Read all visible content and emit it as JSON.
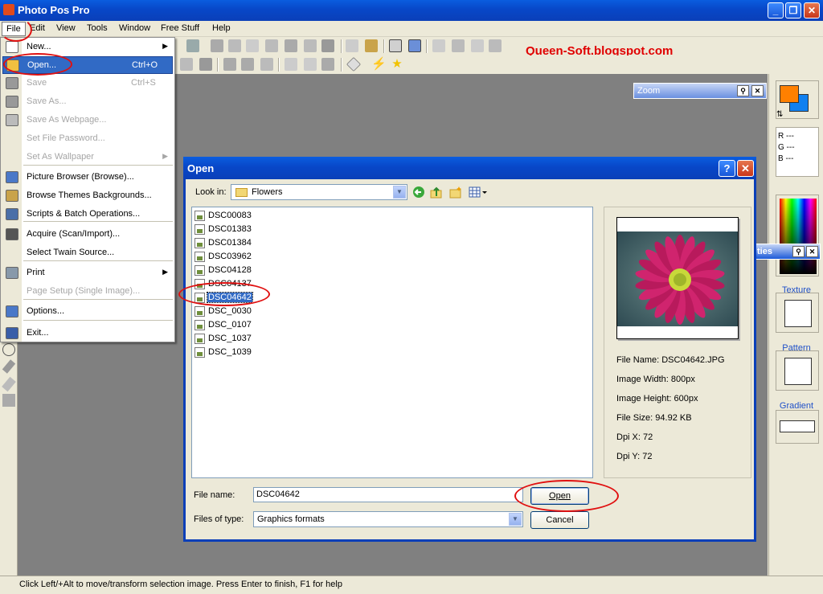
{
  "app": {
    "title": "Photo Pos Pro",
    "window_buttons": {
      "minimize": "_",
      "maximize": "❐",
      "close": "✕"
    }
  },
  "menubar": [
    "File",
    "Edit",
    "View",
    "Tools",
    "Window",
    "Free Stuff",
    "Help"
  ],
  "watermark": "Queen-Soft.blogspot.com",
  "file_menu": {
    "items": [
      {
        "label": "New...",
        "shortcut": "",
        "submenu": true,
        "disabled": false
      },
      {
        "label": "Open...",
        "shortcut": "Ctrl+O",
        "submenu": false,
        "disabled": false,
        "highlighted": true
      },
      {
        "label": "Save",
        "shortcut": "Ctrl+S",
        "submenu": false,
        "disabled": true
      },
      {
        "label": "Save As...",
        "shortcut": "",
        "submenu": false,
        "disabled": true
      },
      {
        "label": "Save As Webpage...",
        "shortcut": "",
        "submenu": false,
        "disabled": true
      },
      {
        "label": "Set File Password...",
        "shortcut": "",
        "submenu": false,
        "disabled": true
      },
      {
        "label": "Set As Wallpaper",
        "shortcut": "",
        "submenu": true,
        "disabled": true
      },
      {
        "label": "Picture Browser (Browse)...",
        "shortcut": "",
        "submenu": false,
        "disabled": false
      },
      {
        "label": "Browse Themes Backgrounds...",
        "shortcut": "",
        "submenu": false,
        "disabled": false
      },
      {
        "label": "Scripts & Batch Operations...",
        "shortcut": "",
        "submenu": false,
        "disabled": false
      },
      {
        "label": "Acquire (Scan/Import)...",
        "shortcut": "",
        "submenu": false,
        "disabled": false
      },
      {
        "label": "Select Twain Source...",
        "shortcut": "",
        "submenu": false,
        "disabled": false
      },
      {
        "label": "Print",
        "shortcut": "",
        "submenu": true,
        "disabled": false
      },
      {
        "label": "Page Setup (Single Image)...",
        "shortcut": "",
        "submenu": false,
        "disabled": true
      },
      {
        "label": "Options...",
        "shortcut": "",
        "submenu": false,
        "disabled": false
      },
      {
        "label": "Exit...",
        "shortcut": "",
        "submenu": false,
        "disabled": false
      }
    ]
  },
  "zoom_panel": {
    "title": "Zoom"
  },
  "properties_panel": {
    "title": "ties"
  },
  "right_panel": {
    "rgb": [
      "R ---",
      "G ---",
      "B ---"
    ],
    "texture_label": "Texture",
    "pattern_label": "Pattern",
    "gradient_label": "Gradient",
    "foreground_color": "#ff8000",
    "background_color": "#1080f0"
  },
  "open_dialog": {
    "title": "Open",
    "help_button": "?",
    "close_button": "✕",
    "look_in_label": "Look in:",
    "look_in_value": "Flowers",
    "files": [
      "DSC00083",
      "DSC01383",
      "DSC01384",
      "DSC03962",
      "DSC04128",
      "DSC04137",
      "DSC04642",
      "DSC_0030",
      "DSC_0107",
      "DSC_1037",
      "DSC_1039"
    ],
    "selected_file": "DSC04642",
    "preview_info": {
      "file_name": "File Name: DSC04642.JPG",
      "image_width": "Image Width: 800px",
      "image_height": "Image Height: 600px",
      "file_size": "File Size: 94.92 KB",
      "dpi_x": "Dpi X: 72",
      "dpi_y": "Dpi Y: 72"
    },
    "file_name_label": "File name:",
    "file_name_value": "DSC04642",
    "files_of_type_label": "Files of type:",
    "files_of_type_value": "Graphics formats",
    "open_button": "Open",
    "cancel_button": "Cancel"
  },
  "status_bar": "Click Left/+Alt to move/transform selection image. Press Enter to finish, F1 for help"
}
